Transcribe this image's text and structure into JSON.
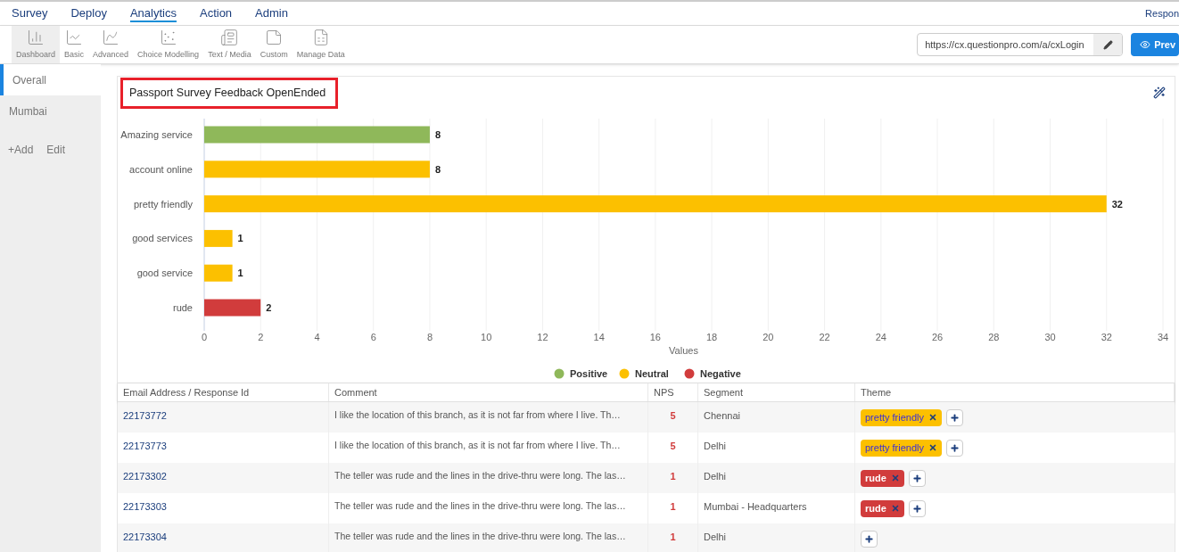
{
  "top_nav": {
    "items": [
      {
        "label": "Survey",
        "selected": false
      },
      {
        "label": "Deploy",
        "selected": false
      },
      {
        "label": "Analytics",
        "selected": true
      },
      {
        "label": "Action",
        "selected": false
      },
      {
        "label": "Admin",
        "selected": false
      }
    ],
    "right_link": "Respon"
  },
  "toolbar": {
    "items": [
      {
        "label": "Dashboard",
        "selected": true
      },
      {
        "label": "Basic",
        "selected": false
      },
      {
        "label": "Advanced",
        "selected": false
      },
      {
        "label": "Choice Modelling",
        "selected": false
      },
      {
        "label": "Text / Media",
        "selected": false
      },
      {
        "label": "Custom",
        "selected": false
      },
      {
        "label": "Manage Data",
        "selected": false
      }
    ],
    "url": "https://cx.questionpro.com/a/cxLogin",
    "preview_button": "Prev"
  },
  "sidebar": {
    "items": [
      {
        "label": "Overall",
        "selected": true
      },
      {
        "label": "Mumbai",
        "selected": false
      }
    ],
    "add": "+Add",
    "edit": "Edit"
  },
  "card": {
    "title": "Passport Survey Feedback OpenEnded",
    "chart_data": {
      "type": "bar",
      "orientation": "horizontal",
      "stacked": true,
      "xlabel": "Values",
      "categories": [
        "Amazing service",
        "account online",
        "pretty friendly",
        "good services",
        "good service",
        "rude"
      ],
      "series": [
        {
          "name": "Positive",
          "color": "#8fb85a",
          "values": [
            8,
            null,
            null,
            null,
            null,
            null
          ]
        },
        {
          "name": "Neutral",
          "color": "#fcc000",
          "values": [
            null,
            8,
            32,
            1,
            1,
            null
          ]
        },
        {
          "name": "Negative",
          "color": "#d13c3c",
          "values": [
            null,
            null,
            null,
            null,
            null,
            2
          ]
        }
      ],
      "grid": true,
      "legend": true,
      "xlim": [
        0,
        34
      ],
      "xticks": [
        0,
        2,
        4,
        6,
        8,
        10,
        12,
        14,
        16,
        18,
        20,
        22,
        24,
        26,
        28,
        30,
        32,
        34
      ],
      "data_labels": true
    }
  },
  "table": {
    "columns": [
      "Email Address / Response Id",
      "Comment",
      "NPS",
      "Segment",
      "Theme"
    ],
    "rows": [
      {
        "id": "22173772",
        "comment": "I like the location of this branch, as it is not far from where I live. Th…",
        "nps": "5",
        "segment": "Chennai",
        "themes": [
          {
            "label": "pretty friendly",
            "color": "#fcc000"
          }
        ]
      },
      {
        "id": "22173773",
        "comment": "I like the location of this branch, as it is not far from where I live. Th…",
        "nps": "5",
        "segment": "Delhi",
        "themes": [
          {
            "label": "pretty friendly",
            "color": "#fcc000"
          }
        ]
      },
      {
        "id": "22173302",
        "comment": "The teller was rude and the lines in the drive-thru were long. The las…",
        "nps": "1",
        "segment": "Delhi",
        "themes": [
          {
            "label": "rude",
            "color": "#d13c3c"
          }
        ]
      },
      {
        "id": "22173303",
        "comment": "The teller was rude and the lines in the drive-thru were long. The las…",
        "nps": "1",
        "segment": "Mumbai - Headquarters",
        "themes": [
          {
            "label": "rude",
            "color": "#d13c3c"
          }
        ]
      },
      {
        "id": "22173304",
        "comment": "The teller was rude and the lines in the drive-thru were long. The las…",
        "nps": "1",
        "segment": "Delhi"
      }
    ]
  }
}
